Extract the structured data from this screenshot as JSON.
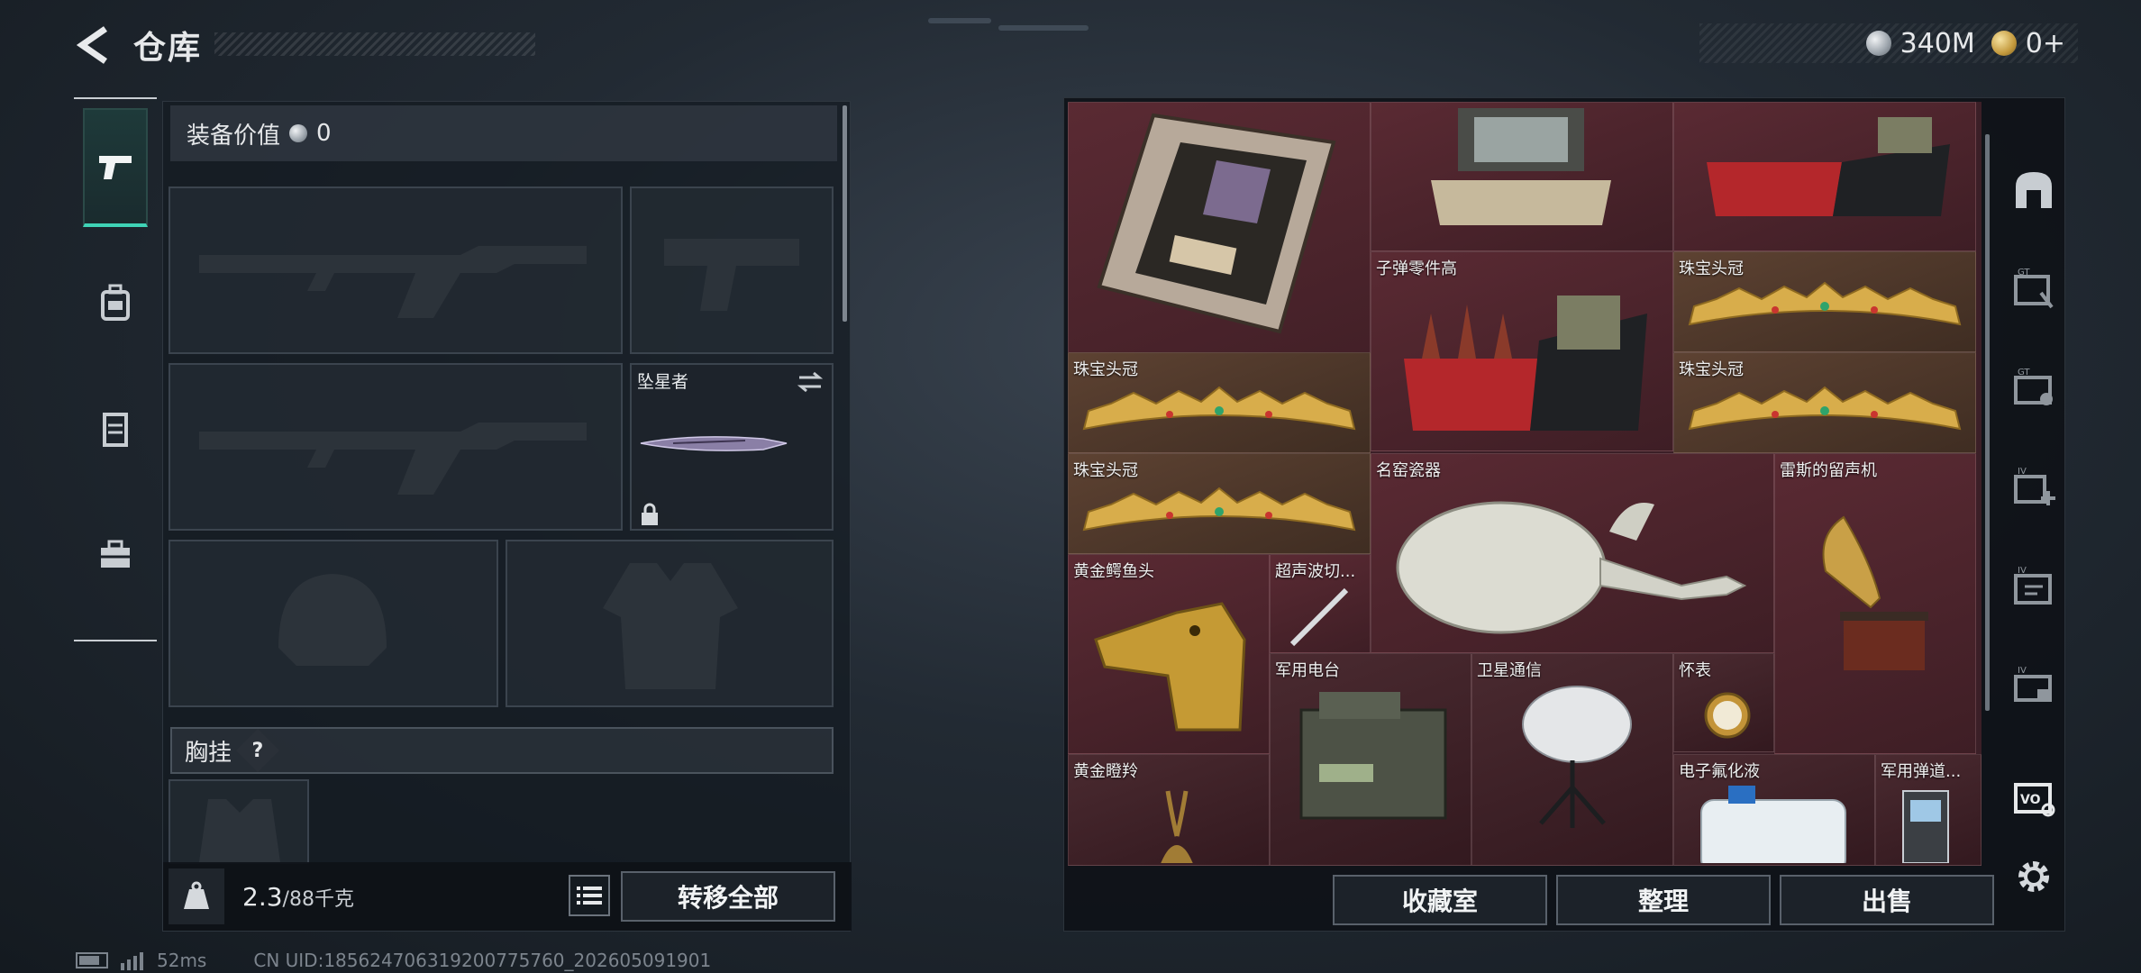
{
  "header": {
    "title": "仓库"
  },
  "currency": {
    "silver_amount": "340M",
    "gold_amount": "0+"
  },
  "left_panel": {
    "equip_value_label": "装备价值",
    "equip_value": "0",
    "melee_slot_label": "坠星者",
    "chest_rig_label": "胸挂",
    "chest_rig_help": "?",
    "weight_current": "2.3",
    "weight_max": "/88千克",
    "transfer_all": "转移全部"
  },
  "grid_items": [
    {
      "label": "子弹零件高"
    },
    {
      "label": "珠宝头冠"
    },
    {
      "label": "珠宝头冠"
    },
    {
      "label": "珠宝头冠"
    },
    {
      "label": "珠宝头冠"
    },
    {
      "label": "名窑瓷器"
    },
    {
      "label": "雷斯的留声机"
    },
    {
      "label": "黄金鳄鱼头"
    },
    {
      "label": "超声波切..."
    },
    {
      "label": "军用电台"
    },
    {
      "label": "卫星通信"
    },
    {
      "label": "怀表"
    },
    {
      "label": "黄金瞪羚"
    },
    {
      "label": "电子氟化液"
    },
    {
      "label": "军用弹道..."
    }
  ],
  "right_footer": {
    "collection": "收藏室",
    "organize": "整理",
    "sell": "出售"
  },
  "right_rail": [
    "vault-icon",
    "gt-plus-icon",
    "gt-expand-icon",
    "iv-plus-icon",
    "iv-folder-icon",
    "iv-box-icon",
    "vo-icon",
    "gear-icon"
  ],
  "status": {
    "ping": "52ms",
    "uid": "CN UID:18562470631920077​5760_202605091901"
  },
  "colors": {
    "accent": "#3fd3b6",
    "grid_red": "#5a2a33",
    "grid_brown": "#5d4232"
  }
}
